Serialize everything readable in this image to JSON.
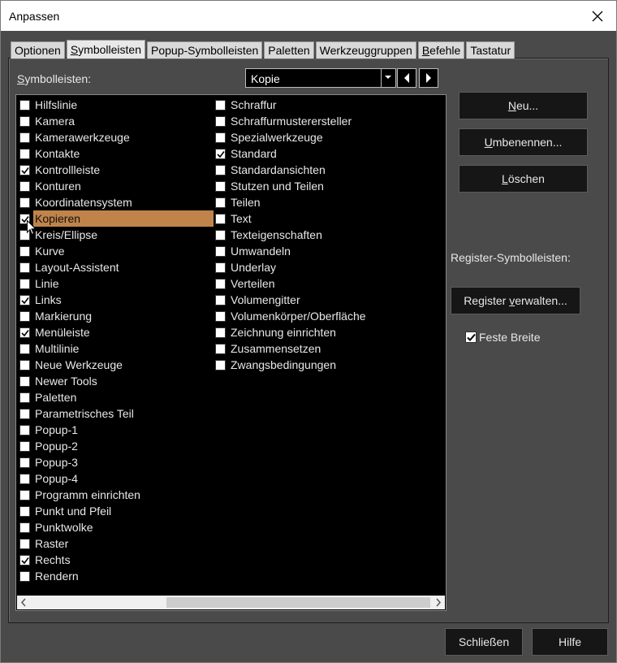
{
  "window": {
    "title": "Anpassen"
  },
  "tabs": [
    {
      "label": "Optionen",
      "active": false
    },
    {
      "label": "Symbolleisten",
      "active": true
    },
    {
      "label": "Popup-Symbolleisten",
      "active": false
    },
    {
      "label": "Paletten",
      "active": false
    },
    {
      "label": "Werkzeuggruppen",
      "active": false
    },
    {
      "label": "Befehle",
      "active": false
    },
    {
      "label": "Tastatur",
      "active": false
    }
  ],
  "toolbars_label": "Symbolleisten:",
  "combo": {
    "value": "Kopie"
  },
  "list": {
    "column1": [
      {
        "label": "Hilfslinie",
        "checked": false
      },
      {
        "label": "Kamera",
        "checked": false
      },
      {
        "label": "Kamerawerkzeuge",
        "checked": false
      },
      {
        "label": "Kontakte",
        "checked": false
      },
      {
        "label": "Kontrollleiste",
        "checked": true
      },
      {
        "label": "Konturen",
        "checked": false
      },
      {
        "label": "Koordinatensystem",
        "checked": false
      },
      {
        "label": "Kopieren",
        "checked": true,
        "selected": true
      },
      {
        "label": "Kreis/Ellipse",
        "checked": false
      },
      {
        "label": "Kurve",
        "checked": false
      },
      {
        "label": "Layout-Assistent",
        "checked": false
      },
      {
        "label": "Linie",
        "checked": false
      },
      {
        "label": "Links",
        "checked": true
      },
      {
        "label": "Markierung",
        "checked": false
      },
      {
        "label": "Menüleiste",
        "checked": true
      },
      {
        "label": "Multilinie",
        "checked": false
      },
      {
        "label": "Neue Werkzeuge",
        "checked": false
      },
      {
        "label": "Newer Tools",
        "checked": false
      },
      {
        "label": "Paletten",
        "checked": false
      },
      {
        "label": "Parametrisches Teil",
        "checked": false
      },
      {
        "label": "Popup-1",
        "checked": false
      },
      {
        "label": "Popup-2",
        "checked": false
      },
      {
        "label": "Popup-3",
        "checked": false
      },
      {
        "label": "Popup-4",
        "checked": false
      },
      {
        "label": "Programm einrichten",
        "checked": false
      },
      {
        "label": "Punkt und Pfeil",
        "checked": false
      },
      {
        "label": "Punktwolke",
        "checked": false
      },
      {
        "label": "Raster",
        "checked": false
      },
      {
        "label": "Rechts",
        "checked": true
      },
      {
        "label": "Rendern",
        "checked": false
      }
    ],
    "column2": [
      {
        "label": "Schraffur",
        "checked": false
      },
      {
        "label": "Schraffurmusterersteller",
        "checked": false
      },
      {
        "label": "Spezialwerkzeuge",
        "checked": false
      },
      {
        "label": "Standard",
        "checked": true
      },
      {
        "label": "Standardansichten",
        "checked": false
      },
      {
        "label": "Stutzen und Teilen",
        "checked": false
      },
      {
        "label": "Teilen",
        "checked": false
      },
      {
        "label": "Text",
        "checked": false
      },
      {
        "label": "Texteigenschaften",
        "checked": false
      },
      {
        "label": "Umwandeln",
        "checked": false
      },
      {
        "label": "Underlay",
        "checked": false
      },
      {
        "label": "Verteilen",
        "checked": false
      },
      {
        "label": "Volumengitter",
        "checked": false
      },
      {
        "label": "Volumenkörper/Oberfläche",
        "checked": false
      },
      {
        "label": "Zeichnung einrichten",
        "checked": false
      },
      {
        "label": "Zusammensetzen",
        "checked": false
      },
      {
        "label": "Zwangsbedingungen",
        "checked": false
      }
    ]
  },
  "buttons": {
    "new": "Neu...",
    "rename": "Umbenennen...",
    "delete": "Löschen",
    "manage_register": "Register verwalten...",
    "close": "Schließen",
    "help": "Hilfe"
  },
  "register_label": "Register-Symbolleisten:",
  "fixed_width": {
    "label": "Feste Breite",
    "checked": true
  },
  "colors": {
    "selection": "#c0844a",
    "background": "#4a4a4a",
    "list_bg": "#000000"
  }
}
